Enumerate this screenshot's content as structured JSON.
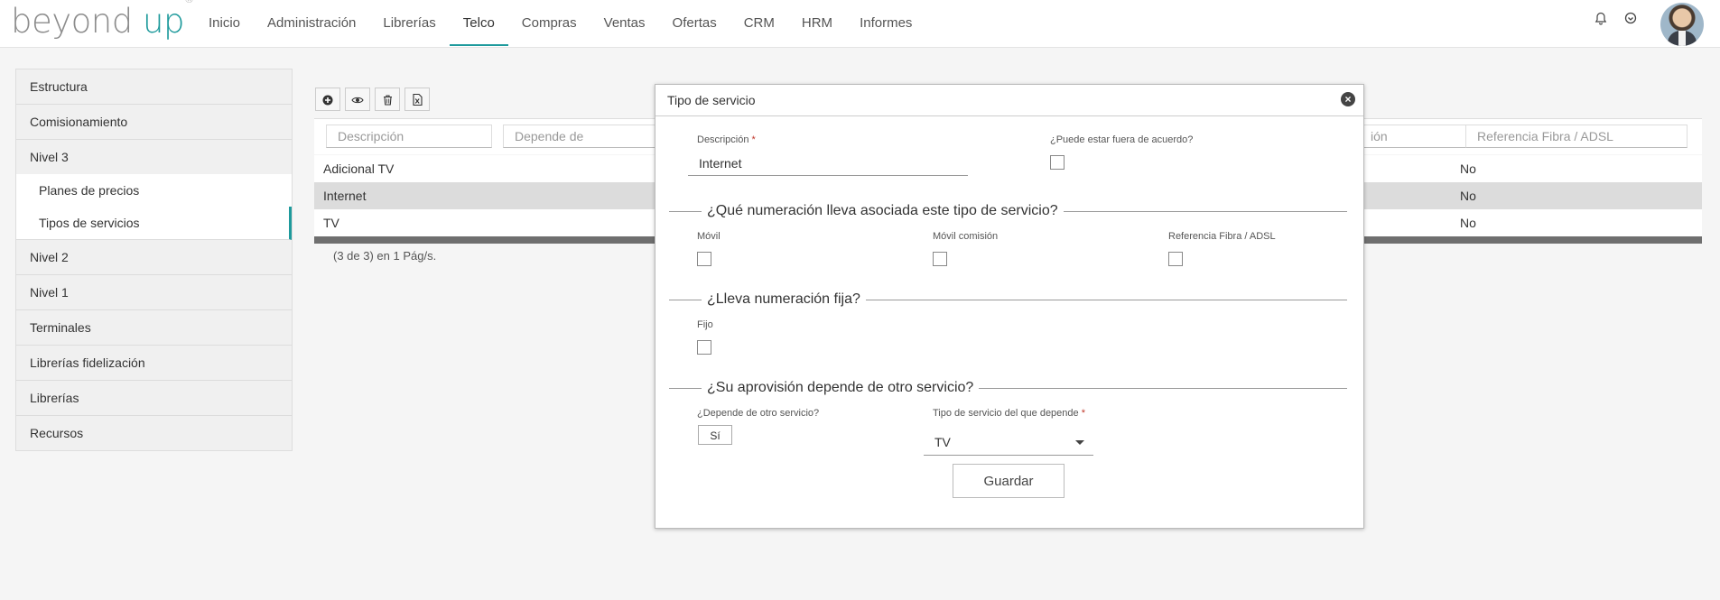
{
  "brand": {
    "name_part1": "beyond",
    "name_part2": "up",
    "mark": "®"
  },
  "nav": {
    "items": [
      {
        "label": "Inicio"
      },
      {
        "label": "Administración"
      },
      {
        "label": "Librerías"
      },
      {
        "label": "Telco",
        "active": true
      },
      {
        "label": "Compras"
      },
      {
        "label": "Ventas"
      },
      {
        "label": "Ofertas"
      },
      {
        "label": "CRM"
      },
      {
        "label": "HRM"
      },
      {
        "label": "Informes"
      }
    ],
    "icons": [
      "bell-icon",
      "power-icon"
    ]
  },
  "sidebar": {
    "items": [
      {
        "label": "Estructura"
      },
      {
        "label": "Comisionamiento"
      },
      {
        "label": "Nivel 3"
      },
      {
        "label": "Planes de precios"
      },
      {
        "label": "Tipos de servicios"
      },
      {
        "label": "Nivel 2"
      },
      {
        "label": "Nivel 1"
      },
      {
        "label": "Terminales"
      },
      {
        "label": "Librerías fidelización"
      },
      {
        "label": "Librerías"
      },
      {
        "label": "Recursos"
      }
    ],
    "active": "Tipos de servicios"
  },
  "toolbar": {
    "icons": [
      "add-icon",
      "view-icon",
      "delete-icon",
      "export-excel-icon"
    ]
  },
  "grid": {
    "filters": {
      "descripcion": "Descripción",
      "depende_de": "Depende de",
      "movil_comision_partial": "ión",
      "referencia": "Referencia Fibra / ADSL"
    },
    "rows": [
      {
        "descripcion": "Adicional TV",
        "referencia": "No"
      },
      {
        "descripcion": "Internet",
        "referencia": "No",
        "selected": true
      },
      {
        "descripcion": "TV",
        "referencia": "No"
      }
    ],
    "paging": "(3 de 3) en 1 Pág/s."
  },
  "modal": {
    "title": "Tipo de servicio",
    "descripcion_label": "Descripción",
    "required_mark": "*",
    "descripcion_value": "Internet",
    "fuera_acuerdo_label": "¿Puede estar fuera de acuerdo?",
    "section_numeracion": "¿Qué numeración lleva asociada este tipo de servicio?",
    "movil_label": "Móvil",
    "movil_comision_label": "Móvil comisión",
    "referencia_label": "Referencia Fibra / ADSL",
    "section_fija": "¿Lleva numeración fija?",
    "fijo_label": "Fijo",
    "section_aprovision": "¿Su aprovisión depende de otro servicio?",
    "depende_label": "¿Depende de otro servicio?",
    "depende_value": "Sí",
    "tipo_depende_label": "Tipo de servicio del que depende",
    "tipo_depende_value": "TV",
    "save_label": "Guardar"
  }
}
